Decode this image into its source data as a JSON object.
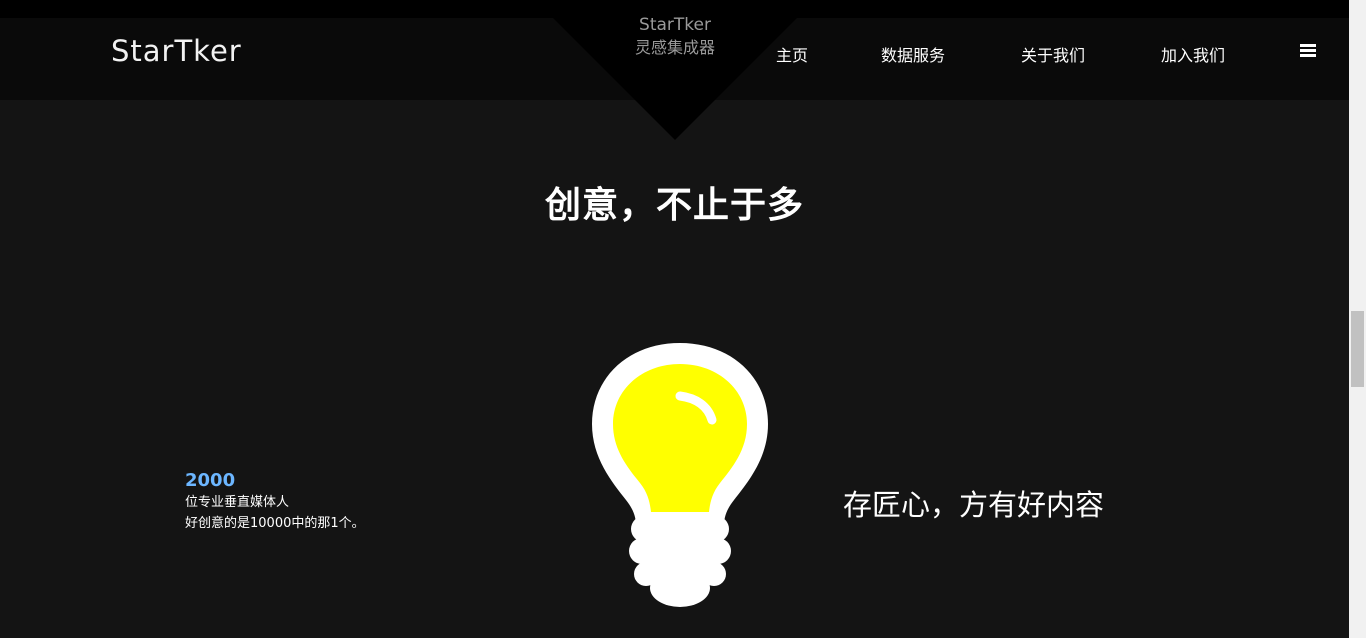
{
  "header": {
    "logo": "StarTker",
    "center_brand": {
      "en": "StarTker",
      "cn": "灵感集成器"
    },
    "nav": [
      "主页",
      "数据服务",
      "关于我们",
      "加入我们"
    ]
  },
  "main": {
    "headline": "创意，不止于多",
    "stat": {
      "number": "2000",
      "line1": "位专业垂直媒体人",
      "line2": "好创意的是10000中的那1个。"
    },
    "tagline": "存匠心，方有好内容"
  },
  "icons": {
    "menu": "hamburger-menu-icon",
    "bulb": "light-bulb-illustration"
  },
  "colors": {
    "accent_blue": "#6cb6ff",
    "bulb_yellow": "#ffff00",
    "background": "#141414"
  }
}
